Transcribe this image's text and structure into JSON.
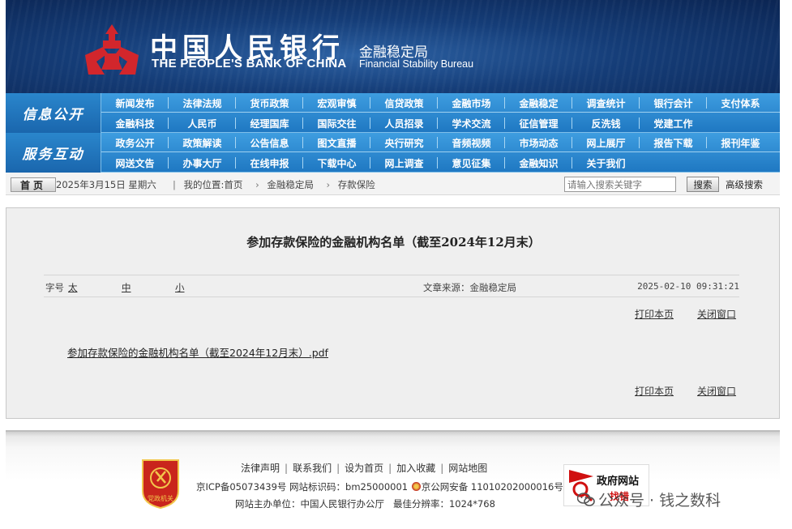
{
  "header": {
    "bank_name_cn": "中国人民银行",
    "bank_name_en": "THE PEOPLE'S BANK OF CHINA",
    "bureau_cn": "金融稳定局",
    "bureau_en": "Financial Stability Bureau"
  },
  "nav": {
    "block1_title": "信息公开",
    "block1_row1": [
      "新闻发布",
      "法律法规",
      "货币政策",
      "宏观审慎",
      "信贷政策",
      "金融市场",
      "金融稳定",
      "调查统计",
      "银行会计",
      "支付体系"
    ],
    "block1_row2": [
      "金融科技",
      "人民币",
      "经理国库",
      "国际交往",
      "人员招录",
      "学术交流",
      "征信管理",
      "反洗钱",
      "党建工作"
    ],
    "block2_title": "服务互动",
    "block2_row1": [
      "政务公开",
      "政策解读",
      "公告信息",
      "图文直播",
      "央行研究",
      "音频视频",
      "市场动态",
      "网上展厅",
      "报告下载",
      "报刊年鉴"
    ],
    "block2_row2": [
      "网送文告",
      "办事大厅",
      "在线申报",
      "下载中心",
      "网上调查",
      "意见征集",
      "金融知识",
      "关于我们"
    ]
  },
  "infobar": {
    "home_label": "首页",
    "date": "2025年3月15日 星期六",
    "location_label": "我的位置:首页",
    "crumb1": "金融稳定局",
    "crumb2": "存款保险",
    "search_placeholder": "请输入搜索关键字",
    "search_button": "搜索",
    "advanced_search": "高级搜索"
  },
  "article": {
    "title": "参加存款保险的金融机构名单（截至2024年12月末）",
    "font_size_label": "字号",
    "font_large": "太",
    "font_medium": "中",
    "font_small": "小",
    "source": "文章来源：金融稳定局",
    "timestamp": "2025-02-10 09:31:21",
    "print_label": "打印本页",
    "close_label": "关闭窗口",
    "attachment": "参加存款保险的金融机构名单（截至2024年12月末）.pdf"
  },
  "footer": {
    "emblem_text": "党政机关",
    "links": [
      "法律声明",
      "联系我们",
      "设为首页",
      "加入收藏",
      "网站地图"
    ],
    "icp": "京ICP备05073439号",
    "site_id": "网站标识码：bm25000001",
    "police": "京公网安备 11010202000016号",
    "sponsor": "网站主办单位：中国人民银行办公厅",
    "resolution": "最佳分辨率：1024*768",
    "gov_badge_line1": "政府网站",
    "gov_badge_line2": "找错",
    "watermark": "公众号 · 钱之数科"
  },
  "colors": {
    "banner_blue": "#153d78",
    "nav_blue": "#2e8ad0",
    "emblem_red": "#d2262c"
  }
}
